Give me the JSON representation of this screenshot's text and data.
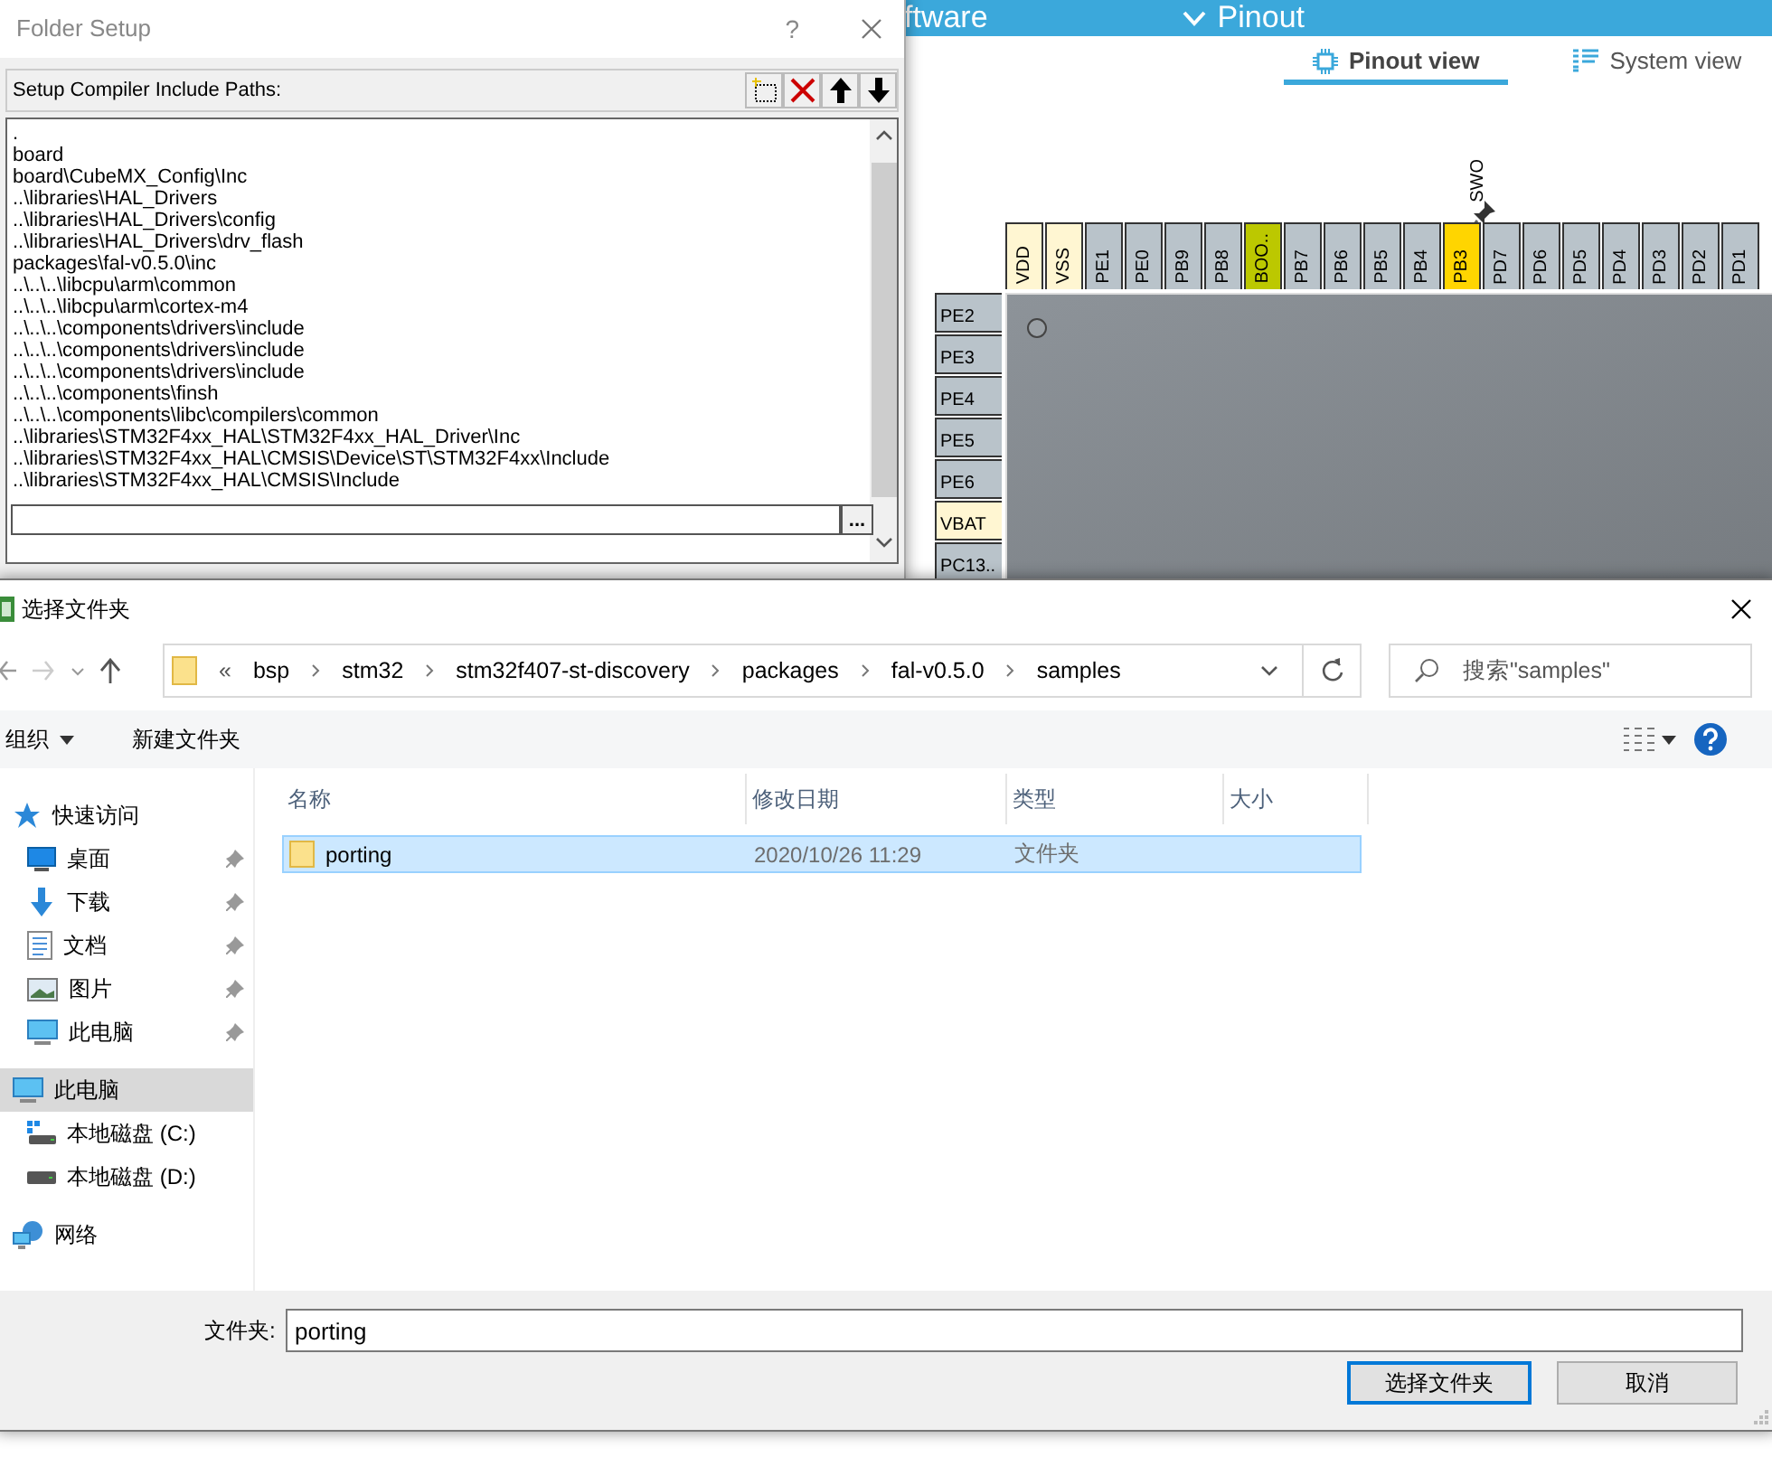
{
  "app": {
    "header_fragment": "ftware",
    "header_menu": "Pinout",
    "views": [
      {
        "label": "Pinout view",
        "selected": true
      },
      {
        "label": "System view",
        "selected": false
      }
    ],
    "pin_signal": "SWO",
    "top_pins": [
      {
        "label": "VDD",
        "color": "#fff6d2"
      },
      {
        "label": "VSS",
        "color": "#fff6d2"
      },
      {
        "label": "PE1",
        "color": "#b9c3ca"
      },
      {
        "label": "PE0",
        "color": "#b9c3ca"
      },
      {
        "label": "PB9",
        "color": "#b9c3ca"
      },
      {
        "label": "PB8",
        "color": "#b9c3ca"
      },
      {
        "label": "BOO..",
        "color": "#bcc800"
      },
      {
        "label": "PB7",
        "color": "#b9c3ca"
      },
      {
        "label": "PB6",
        "color": "#b9c3ca"
      },
      {
        "label": "PB5",
        "color": "#b9c3ca"
      },
      {
        "label": "PB4",
        "color": "#b9c3ca"
      },
      {
        "label": "PB3",
        "color": "#ffd500"
      },
      {
        "label": "PD7",
        "color": "#b9c3ca"
      },
      {
        "label": "PD6",
        "color": "#b9c3ca"
      },
      {
        "label": "PD5",
        "color": "#b9c3ca"
      },
      {
        "label": "PD4",
        "color": "#b9c3ca"
      },
      {
        "label": "PD3",
        "color": "#b9c3ca"
      },
      {
        "label": "PD2",
        "color": "#b9c3ca"
      },
      {
        "label": "PD1",
        "color": "#b9c3ca"
      }
    ],
    "left_pins": [
      {
        "label": "PE2",
        "color": "#b9c3ca"
      },
      {
        "label": "PE3",
        "color": "#b9c3ca"
      },
      {
        "label": "PE4",
        "color": "#b9c3ca"
      },
      {
        "label": "PE5",
        "color": "#b9c3ca"
      },
      {
        "label": "PE6",
        "color": "#b9c3ca"
      },
      {
        "label": "VBAT",
        "color": "#fff6d2"
      },
      {
        "label": "PC13..",
        "color": "#b9c3ca"
      }
    ]
  },
  "folder_setup": {
    "title": "Folder Setup",
    "help": "?",
    "list_label": "Setup Compiler Include Paths:",
    "paths": [
      ".",
      "board",
      "board\\CubeMX_Config\\Inc",
      "..\\libraries\\HAL_Drivers",
      "..\\libraries\\HAL_Drivers\\config",
      "..\\libraries\\HAL_Drivers\\drv_flash",
      "packages\\fal-v0.5.0\\inc",
      "..\\..\\..\\libcpu\\arm\\common",
      "..\\..\\..\\libcpu\\arm\\cortex-m4",
      "..\\..\\..\\components\\drivers\\include",
      "..\\..\\..\\components\\drivers\\include",
      "..\\..\\..\\components\\drivers\\include",
      "..\\..\\..\\components\\finsh",
      "..\\..\\..\\components\\libc\\compilers\\common",
      "..\\libraries\\STM32F4xx_HAL\\STM32F4xx_HAL_Driver\\Inc",
      "..\\libraries\\STM32F4xx_HAL\\CMSIS\\Device\\ST\\STM32F4xx\\Include",
      "..\\libraries\\STM32F4xx_HAL\\CMSIS\\Include"
    ],
    "browse": "..."
  },
  "file_dialog": {
    "title": "选择文件夹",
    "breadcrumb_overflow": "«",
    "breadcrumb": [
      "bsp",
      "stm32",
      "stm32f407-st-discovery",
      "packages",
      "fal-v0.5.0",
      "samples"
    ],
    "search": {
      "placeholder": "搜索\"samples\""
    },
    "toolbar": {
      "organize": "组织",
      "new_folder": "新建文件夹"
    },
    "nav": [
      {
        "label": "快速访问",
        "kind": "star",
        "group": true,
        "pinned": false,
        "selected": false
      },
      {
        "label": "桌面",
        "kind": "desktop",
        "group": false,
        "pinned": true,
        "selected": false
      },
      {
        "label": "下载",
        "kind": "download",
        "group": false,
        "pinned": true,
        "selected": false
      },
      {
        "label": "文档",
        "kind": "document",
        "group": false,
        "pinned": true,
        "selected": false
      },
      {
        "label": "图片",
        "kind": "pictures",
        "group": false,
        "pinned": true,
        "selected": false
      },
      {
        "label": "此电脑",
        "kind": "computer",
        "group": false,
        "pinned": true,
        "selected": false
      },
      {
        "label": "此电脑",
        "kind": "computer",
        "group": true,
        "pinned": false,
        "selected": true
      },
      {
        "label": "本地磁盘 (C:)",
        "kind": "system-drive",
        "group": false,
        "pinned": false,
        "selected": false
      },
      {
        "label": "本地磁盘 (D:)",
        "kind": "drive",
        "group": false,
        "pinned": false,
        "selected": false
      },
      {
        "label": "网络",
        "kind": "network",
        "group": true,
        "pinned": false,
        "selected": false
      }
    ],
    "columns": [
      "名称",
      "修改日期",
      "类型",
      "大小"
    ],
    "rows": [
      {
        "name": "porting",
        "modified": "2020/10/26 11:29",
        "type": "文件夹",
        "selected": true
      }
    ],
    "folder_label": "文件夹:",
    "folder_value": "porting",
    "buttons": [
      {
        "label": "选择文件夹",
        "default": true
      },
      {
        "label": "取消",
        "default": false
      }
    ]
  }
}
